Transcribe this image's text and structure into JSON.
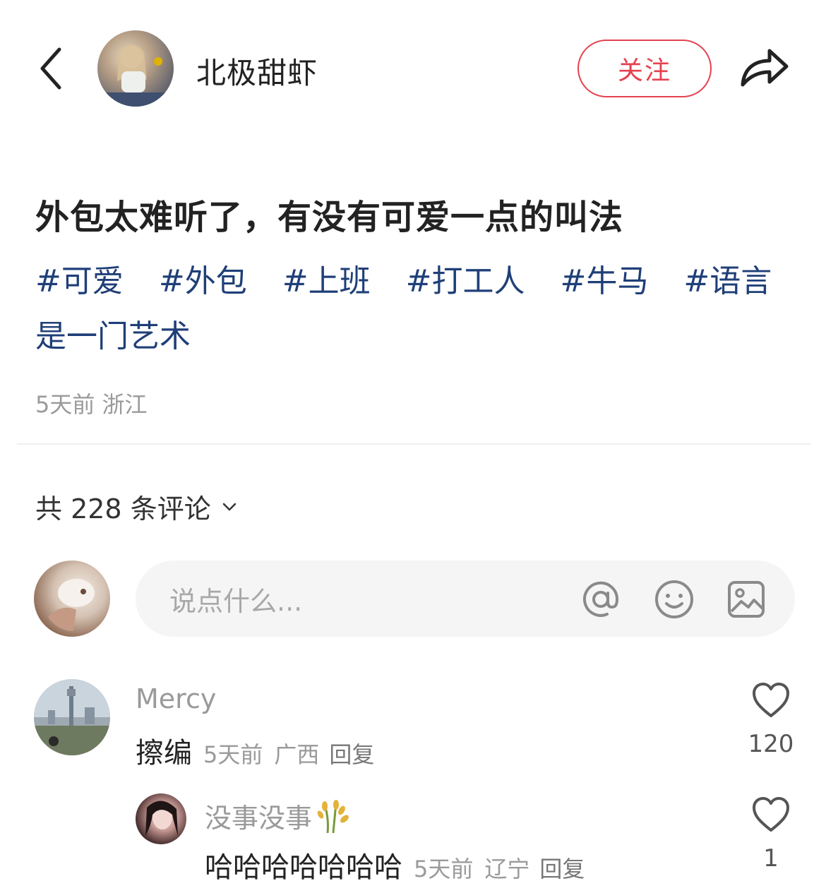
{
  "header": {
    "author_name": "北极甜虾",
    "follow_label": "关注",
    "icons": {
      "back": "back-chevron-icon",
      "share": "share-arrow-icon"
    },
    "accent_color": "#e5414f"
  },
  "post": {
    "title": "外包太难听了，有没有可爱一点的叫法",
    "tags": [
      "#可爱",
      "#外包",
      "#上班",
      "#打工人",
      "#牛马",
      "#语言是一门艺术"
    ],
    "time": "5天前",
    "location": "浙江",
    "tag_color": "#1f3f78"
  },
  "comments_section": {
    "count_label": "共 228 条评论",
    "input_placeholder": "说点什么...",
    "input_icons": [
      "at-icon",
      "emoji-icon",
      "image-icon"
    ],
    "comments": [
      {
        "user": "Mercy",
        "text": "擦编",
        "time": "5天前",
        "location": "广西",
        "reply_label": "回复",
        "likes": "120",
        "replies": [
          {
            "user": "没事没事",
            "user_badge": "wheat-icon",
            "text": "哈哈哈哈哈哈哈",
            "time": "5天前",
            "location": "辽宁",
            "reply_label": "回复",
            "likes": "1"
          }
        ]
      }
    ]
  }
}
